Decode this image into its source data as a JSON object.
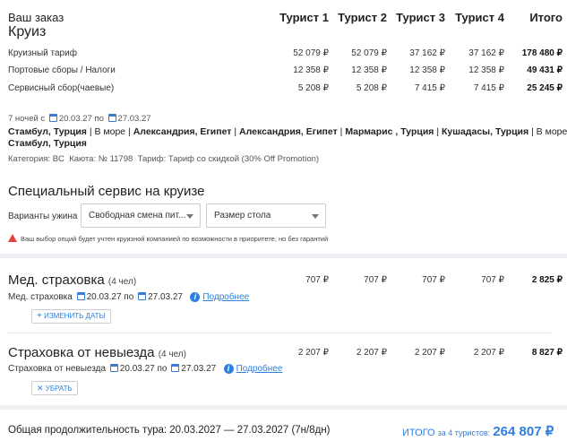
{
  "order": {
    "heading": "Ваш заказ",
    "subheading": "Круиз",
    "tourists": [
      "Турист 1",
      "Турист 2",
      "Турист 3",
      "Турист 4"
    ],
    "total_label": "Итого",
    "rows": [
      {
        "label": "Круизный тариф",
        "values": [
          "52 079 ₽",
          "52 079 ₽",
          "37 162 ₽",
          "37 162 ₽"
        ],
        "total": "178 480 ₽"
      },
      {
        "label": "Портовые сборы / Налоги",
        "values": [
          "12 358 ₽",
          "12 358 ₽",
          "12 358 ₽",
          "12 358 ₽"
        ],
        "total": "49 431 ₽"
      },
      {
        "label": "Сервисный сбор(чаевые)",
        "values": [
          "5 208 ₽",
          "5 208 ₽",
          "7 415 ₽",
          "7 415 ₽"
        ],
        "total": "25 245 ₽"
      }
    ]
  },
  "cruise": {
    "nights": "7 ночей с",
    "date_from": "20.03.27",
    "by": "по",
    "date_to": "27.03.27",
    "route_line1_bold": "Стамбул, Турция",
    "route_line1_rest": " | В море | ",
    "route_seg2": "Александрия, Египет",
    "route_sep": " | ",
    "route_seg3": "Александрия, Египет",
    "route_seg4": "Мармарис , Турция",
    "route_seg5": "Кушадасы, Турция",
    "route_tail": " | В море |",
    "route_line2": "Стамбул, Турция",
    "category_label": "Категория:",
    "category": "BC",
    "cabin_label": "Каюта:",
    "cabin": "№ 11798",
    "tariff_label": "Тариф:",
    "tariff": "Тариф со скидкой (30% Off Promotion)"
  },
  "special_service": {
    "title": "Специальный сервис на круизе",
    "dinner_label": "Варианты ужина",
    "dinner_value": "Свободная смена пит...",
    "table_value": "Размер стола",
    "warning": "Ваш выбор опций будет учтен круизной компанией по возможности в приоритете, но без гарантий"
  },
  "medical": {
    "title": "Мед. страховка",
    "count": "(4 чел)",
    "values": [
      "707 ₽",
      "707 ₽",
      "707 ₽",
      "707 ₽"
    ],
    "total": "2 825 ₽",
    "item_label": "Мед. страховка",
    "date_from": "20.03.27",
    "by": "по",
    "date_to": "27.03.27",
    "more_link": "Подробнее",
    "change_button": "ИЗМЕНИТЬ ДАТЫ"
  },
  "cancel": {
    "title": "Страховка от невыезда",
    "count": "(4 чел)",
    "values": [
      "2 207 ₽",
      "2 207 ₽",
      "2 207 ₽",
      "2 207 ₽"
    ],
    "total": "8 827 ₽",
    "item_label": "Страховка от невыезда",
    "date_from": "20.03.27",
    "by": "по",
    "date_to": "27.03.27",
    "more_link": "Подробнее",
    "remove_button": "УБРАТЬ"
  },
  "footer": {
    "duration_label": "Общая продолжительность тура: 20.03.2027 — 27.03.2027 (7н/8дн)",
    "total_label": "ИТОГО",
    "total_for": "за 4 туристов:",
    "total_value": "264 807 ₽"
  }
}
